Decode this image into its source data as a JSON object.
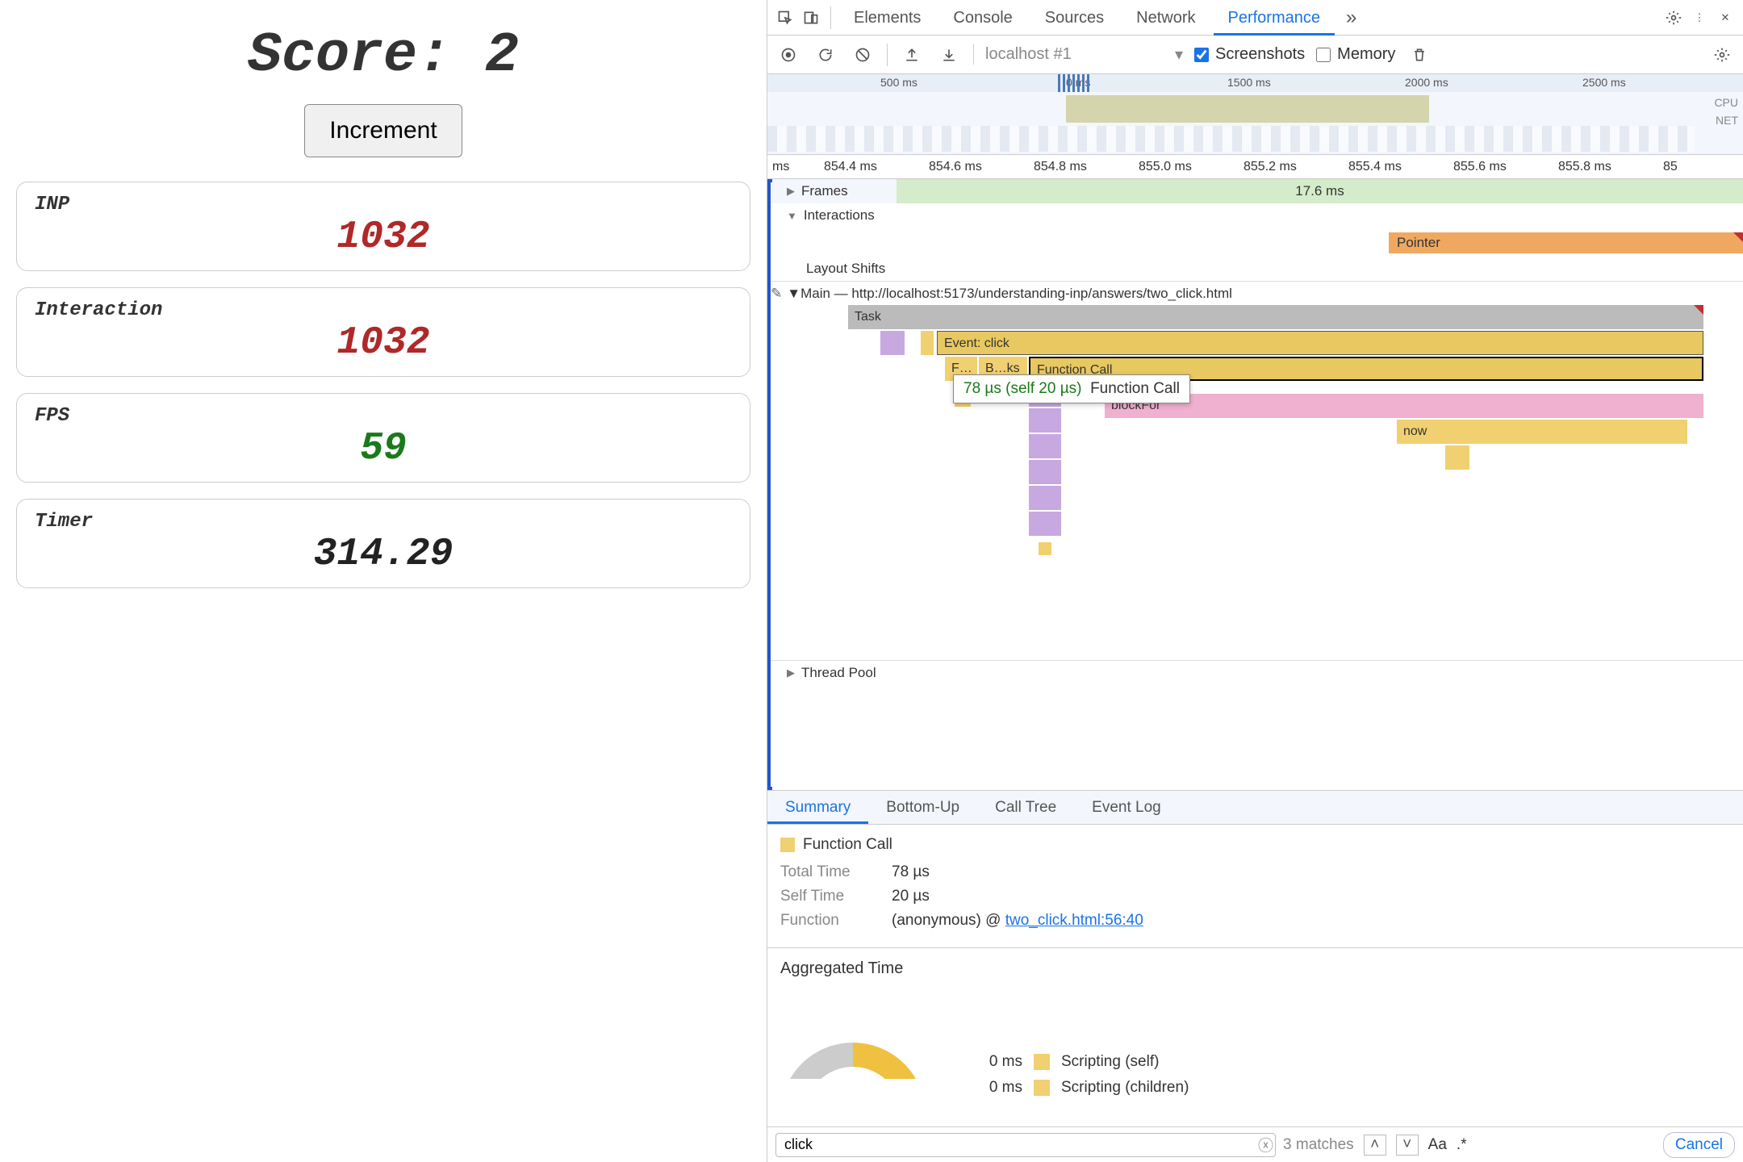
{
  "app": {
    "score_label": "Score:",
    "score_value": "2",
    "increment_label": "Increment",
    "cards": {
      "inp": {
        "label": "INP",
        "value": "1032"
      },
      "interaction": {
        "label": "Interaction",
        "value": "1032"
      },
      "fps": {
        "label": "FPS",
        "value": "59"
      },
      "timer": {
        "label": "Timer",
        "value": "314.29"
      }
    }
  },
  "devtools": {
    "tabs": {
      "elements": "Elements",
      "console": "Console",
      "sources": "Sources",
      "network": "Network",
      "performance": "Performance"
    },
    "toolbar": {
      "profile_selector": "localhost #1",
      "screenshots_label": "Screenshots",
      "memory_label": "Memory"
    },
    "overview_ticks": [
      "500 ms",
      "0 ms",
      "1500 ms",
      "2000 ms",
      "2500 ms"
    ],
    "overview_labels": {
      "cpu": "CPU",
      "net": "NET"
    },
    "flame_ruler": [
      "ms",
      "854.4 ms",
      "854.6 ms",
      "854.8 ms",
      "855.0 ms",
      "855.2 ms",
      "855.4 ms",
      "855.6 ms",
      "855.8 ms",
      "85"
    ],
    "tracks": {
      "frames": {
        "label": "Frames",
        "value": "17.6 ms"
      },
      "interactions": {
        "label": "Interactions",
        "pointer": "Pointer"
      },
      "layout_shifts": "Layout Shifts",
      "main": "Main — http://localhost:5173/understanding-inp/answers/two_click.html",
      "thread_pool": "Thread Pool"
    },
    "flame": {
      "task": "Task",
      "event_click": "Event: click",
      "fc_short1": "F…",
      "fc_short2": "B…ks",
      "fc_label": "Function Call",
      "blockfor": "blockFor",
      "now": "now"
    },
    "tooltip": {
      "timing": "78 µs (self 20 µs)",
      "name": "Function Call"
    },
    "summary_tabs": {
      "summary": "Summary",
      "bottom_up": "Bottom-Up",
      "call_tree": "Call Tree",
      "event_log": "Event Log"
    },
    "summary": {
      "title": "Function Call",
      "total_time_k": "Total Time",
      "total_time_v": "78 µs",
      "self_time_k": "Self Time",
      "self_time_v": "20 µs",
      "function_k": "Function",
      "function_v": "(anonymous) @ ",
      "function_link": "two_click.html:56:40"
    },
    "aggregated": {
      "title": "Aggregated Time",
      "rows": [
        {
          "time": "0 ms",
          "label": "Scripting (self)"
        },
        {
          "time": "0 ms",
          "label": "Scripting (children)"
        }
      ]
    },
    "search": {
      "value": "click",
      "matches": "3 matches",
      "aa": "Aa",
      "regex": ".*",
      "cancel": "Cancel"
    }
  }
}
